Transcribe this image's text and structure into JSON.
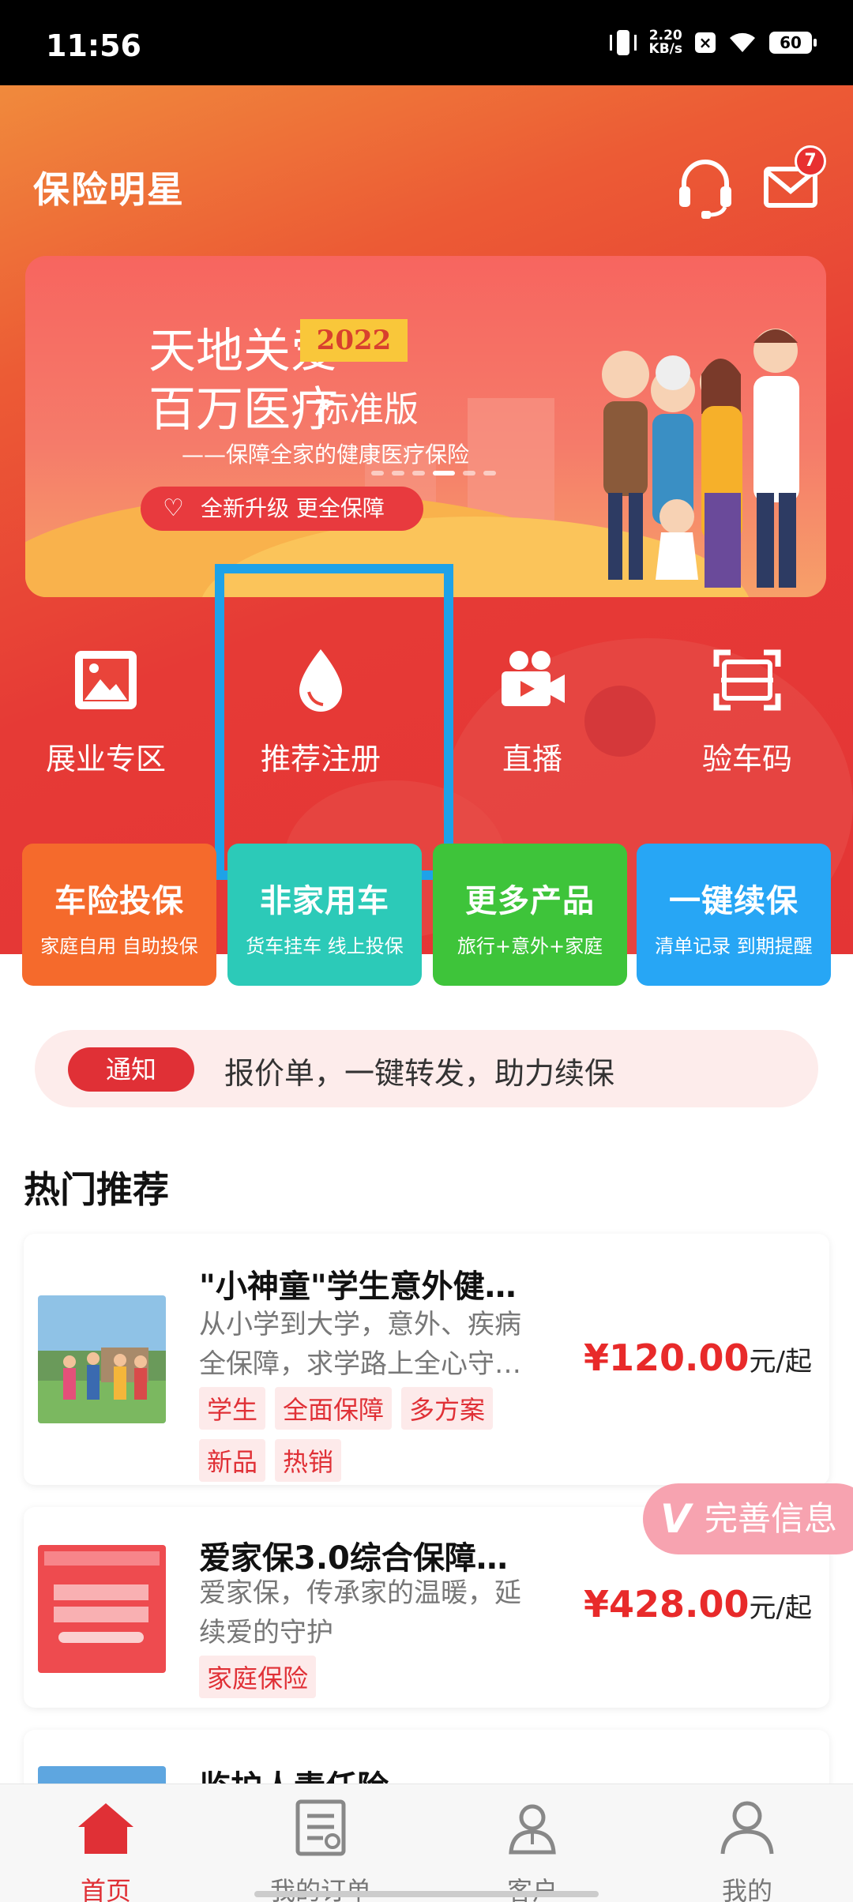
{
  "status": {
    "time": "11:56",
    "net_speed": "2.20",
    "net_unit": "KB/s",
    "battery": "60"
  },
  "header": {
    "title": "保险明星",
    "mail_badge": "7",
    "icons": [
      "headset-icon",
      "mail-icon"
    ]
  },
  "banner": {
    "line1": "天地关爱",
    "year": "2022",
    "line2": "百万医疗",
    "edition": "标准版",
    "subtitle": "——保障全家的健康医疗保险",
    "pill": "全新升级 更全保障",
    "active_slide": 3,
    "slide_count": 6
  },
  "quick_actions": [
    {
      "label": "展业专区",
      "icon": "image-icon"
    },
    {
      "label": "推荐注册",
      "icon": "drop-icon"
    },
    {
      "label": "直播",
      "icon": "video-camera-icon"
    },
    {
      "label": "验车码",
      "icon": "scan-icon"
    }
  ],
  "service_cards": [
    {
      "title": "车险投保",
      "subtitle": "家庭自用 自助投保",
      "color": "#f56a2c"
    },
    {
      "title": "非家用车",
      "subtitle": "货车挂车 线上投保",
      "color": "#2ccab8"
    },
    {
      "title": "更多产品",
      "subtitle": "旅行+意外+家庭",
      "color": "#3ec43a"
    },
    {
      "title": "一键续保",
      "subtitle": "清单记录 到期提醒",
      "color": "#27a6f5"
    }
  ],
  "notice": {
    "tag": "通知",
    "text": "报价单，一键转发，助力续保"
  },
  "section_title": "热门推荐",
  "products": [
    {
      "title": "\"小神童\"学生意外健…",
      "desc": "从小学到大学，意外、疾病全保障，求学路上全心守…",
      "tags": [
        "学生",
        "全面保障",
        "多方案",
        "新品",
        "热销"
      ],
      "price": "¥120.00",
      "unit": "元/起"
    },
    {
      "title": "爱家保3.0综合保障…",
      "desc": "爱家保，传承家的温暖，延续爱的守护",
      "tags": [
        "家庭保险"
      ],
      "price": "¥428.00",
      "unit": "元/起"
    },
    {
      "title": "监护人责任险"
    }
  ],
  "floating": {
    "label": "完善信息",
    "mark": "V"
  },
  "tabbar": [
    {
      "label": "首页",
      "icon": "home-icon",
      "active": true
    },
    {
      "label": "我的订单",
      "icon": "order-icon",
      "active": false
    },
    {
      "label": "客户",
      "icon": "customer-icon",
      "active": false
    },
    {
      "label": "我的",
      "icon": "profile-icon",
      "active": false
    }
  ]
}
